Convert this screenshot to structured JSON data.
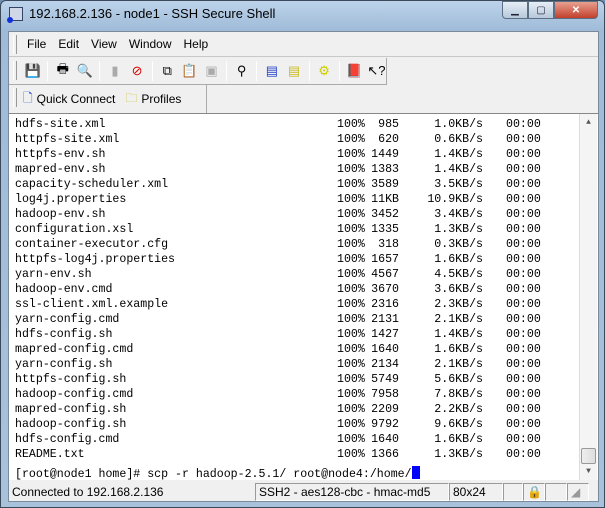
{
  "window": {
    "title": "192.168.2.136 - node1 - SSH Secure Shell",
    "controls": [
      "minimize",
      "maximize",
      "close"
    ]
  },
  "menu": [
    "File",
    "Edit",
    "View",
    "Window",
    "Help"
  ],
  "toolbar": {
    "icons": [
      "save-icon",
      "print-icon",
      "print-preview-icon",
      "disconnect-icon",
      "disabled-connect-icon",
      "copy-icon",
      "paste-icon",
      "paste-disabled-icon",
      "find-icon",
      "new-terminal-icon",
      "new-file-transfer-icon",
      "settings-icon",
      "help-book-icon",
      "context-help-icon"
    ]
  },
  "quickbar": {
    "quick_connect": "Quick Connect",
    "profiles": "Profiles"
  },
  "terminal": {
    "rows": [
      {
        "name": "hdfs-site.xml",
        "pct": "100%",
        "size": "985",
        "rate": "1.0KB/s",
        "time": "00:00"
      },
      {
        "name": "httpfs-site.xml",
        "pct": "100%",
        "size": "620",
        "rate": "0.6KB/s",
        "time": "00:00"
      },
      {
        "name": "httpfs-env.sh",
        "pct": "100%",
        "size": "1449",
        "rate": "1.4KB/s",
        "time": "00:00"
      },
      {
        "name": "mapred-env.sh",
        "pct": "100%",
        "size": "1383",
        "rate": "1.4KB/s",
        "time": "00:00"
      },
      {
        "name": "capacity-scheduler.xml",
        "pct": "100%",
        "size": "3589",
        "rate": "3.5KB/s",
        "time": "00:00"
      },
      {
        "name": "log4j.properties",
        "pct": "100%",
        "size": "11KB",
        "rate": "10.9KB/s",
        "time": "00:00"
      },
      {
        "name": "hadoop-env.sh",
        "pct": "100%",
        "size": "3452",
        "rate": "3.4KB/s",
        "time": "00:00"
      },
      {
        "name": "configuration.xsl",
        "pct": "100%",
        "size": "1335",
        "rate": "1.3KB/s",
        "time": "00:00"
      },
      {
        "name": "container-executor.cfg",
        "pct": "100%",
        "size": "318",
        "rate": "0.3KB/s",
        "time": "00:00"
      },
      {
        "name": "httpfs-log4j.properties",
        "pct": "100%",
        "size": "1657",
        "rate": "1.6KB/s",
        "time": "00:00"
      },
      {
        "name": "yarn-env.sh",
        "pct": "100%",
        "size": "4567",
        "rate": "4.5KB/s",
        "time": "00:00"
      },
      {
        "name": "hadoop-env.cmd",
        "pct": "100%",
        "size": "3670",
        "rate": "3.6KB/s",
        "time": "00:00"
      },
      {
        "name": "ssl-client.xml.example",
        "pct": "100%",
        "size": "2316",
        "rate": "2.3KB/s",
        "time": "00:00"
      },
      {
        "name": "yarn-config.cmd",
        "pct": "100%",
        "size": "2131",
        "rate": "2.1KB/s",
        "time": "00:00"
      },
      {
        "name": "hdfs-config.sh",
        "pct": "100%",
        "size": "1427",
        "rate": "1.4KB/s",
        "time": "00:00"
      },
      {
        "name": "mapred-config.cmd",
        "pct": "100%",
        "size": "1640",
        "rate": "1.6KB/s",
        "time": "00:00"
      },
      {
        "name": "yarn-config.sh",
        "pct": "100%",
        "size": "2134",
        "rate": "2.1KB/s",
        "time": "00:00"
      },
      {
        "name": "httpfs-config.sh",
        "pct": "100%",
        "size": "5749",
        "rate": "5.6KB/s",
        "time": "00:00"
      },
      {
        "name": "hadoop-config.cmd",
        "pct": "100%",
        "size": "7958",
        "rate": "7.8KB/s",
        "time": "00:00"
      },
      {
        "name": "mapred-config.sh",
        "pct": "100%",
        "size": "2209",
        "rate": "2.2KB/s",
        "time": "00:00"
      },
      {
        "name": "hadoop-config.sh",
        "pct": "100%",
        "size": "9792",
        "rate": "9.6KB/s",
        "time": "00:00"
      },
      {
        "name": "hdfs-config.cmd",
        "pct": "100%",
        "size": "1640",
        "rate": "1.6KB/s",
        "time": "00:00"
      },
      {
        "name": "README.txt",
        "pct": "100%",
        "size": "1366",
        "rate": "1.3KB/s",
        "time": "00:00"
      }
    ],
    "prompt": "[root@node1 home]# scp -r hadoop-2.5.1/ root@node4:/home/",
    "cursor_color": "#0000ff"
  },
  "status": {
    "connection": "Connected to 192.168.2.136",
    "cipher": "SSH2 - aes128-cbc - hmac-md5",
    "size": "80x24"
  }
}
